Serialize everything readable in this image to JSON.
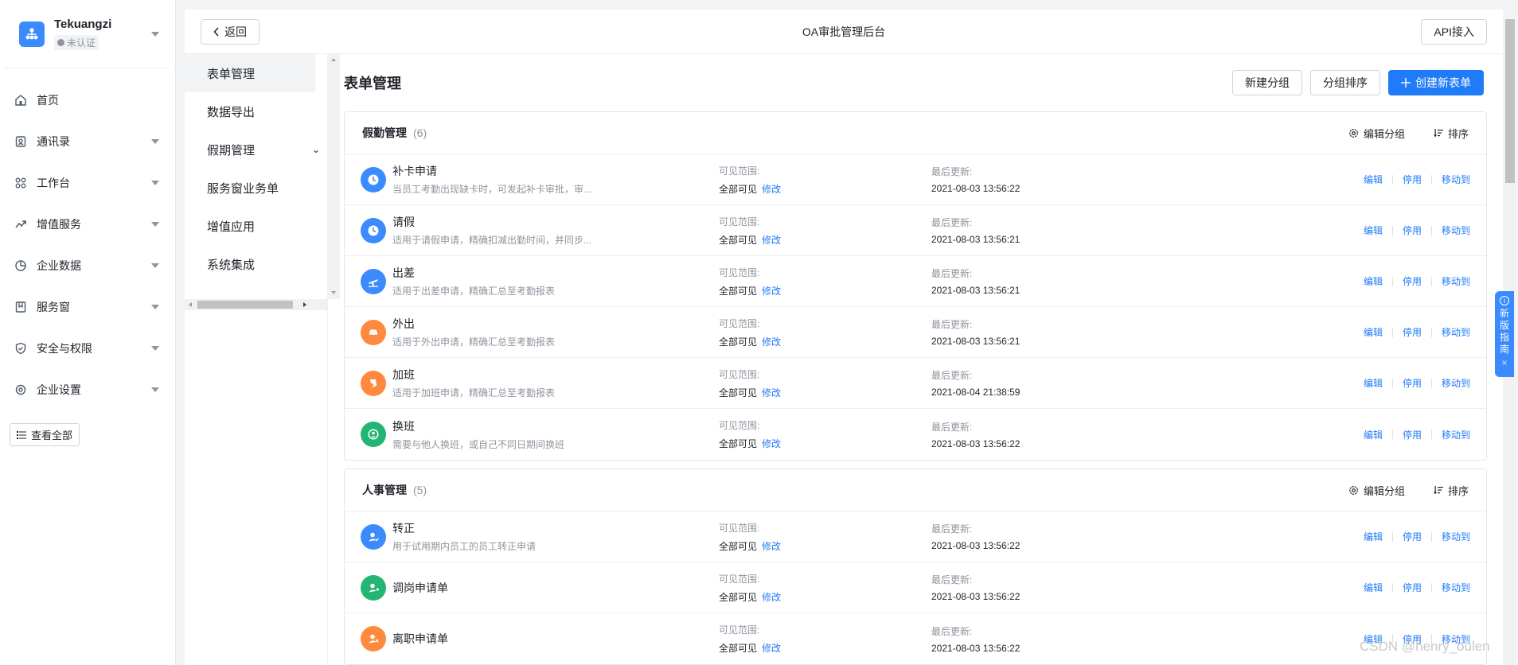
{
  "org": {
    "name": "Tekuangzi",
    "status": "未认证"
  },
  "nav": [
    {
      "label": "首页",
      "icon": "home-icon",
      "caret": false
    },
    {
      "label": "通讯录",
      "icon": "contacts-icon",
      "caret": true
    },
    {
      "label": "工作台",
      "icon": "grid-icon",
      "caret": true
    },
    {
      "label": "增值服务",
      "icon": "trend-icon",
      "caret": true
    },
    {
      "label": "企业数据",
      "icon": "pie-chart-icon",
      "caret": true
    },
    {
      "label": "服务窗",
      "icon": "bookmark-icon",
      "caret": true
    },
    {
      "label": "安全与权限",
      "icon": "shield-icon",
      "caret": true
    },
    {
      "label": "企业设置",
      "icon": "settings-icon",
      "caret": true
    }
  ],
  "view_all": "查看全部",
  "topbar": {
    "back": "返回",
    "title": "OA审批管理后台",
    "api": "API接入"
  },
  "submenu": [
    {
      "label": "表单管理",
      "active": true
    },
    {
      "label": "数据导出"
    },
    {
      "label": "假期管理",
      "expand": "⌄"
    },
    {
      "label": "服务窗业务单"
    },
    {
      "label": "增值应用"
    },
    {
      "label": "系统集成"
    }
  ],
  "main": {
    "title": "表单管理",
    "new_group": "新建分组",
    "sort_groups": "分组排序",
    "create_form": "创建新表单"
  },
  "labels": {
    "scope": "可见范围:",
    "updated": "最后更新:",
    "edit_group": "编辑分组",
    "sort": "排序",
    "modify": "修改",
    "edit": "编辑",
    "disable": "停用",
    "move": "移动到"
  },
  "groups": [
    {
      "name": "假勤管理",
      "count": "(6)",
      "forms": [
        {
          "name": "补卡申请",
          "desc": "当员工考勤出现缺卡时，可发起补卡审批，审...",
          "scope": "全部可见",
          "updated": "2021-08-03 13:56:22",
          "color": "#3b8bff",
          "icon": "clock-icon"
        },
        {
          "name": "请假",
          "desc": "适用于请假申请，精确扣减出勤时间，并同步...",
          "scope": "全部可见",
          "updated": "2021-08-03 13:56:21",
          "color": "#3b8bff",
          "icon": "clock-icon"
        },
        {
          "name": "出差",
          "desc": "适用于出差申请，精确汇总至考勤报表",
          "scope": "全部可见",
          "updated": "2021-08-03 13:56:21",
          "color": "#3b8bff",
          "icon": "plane-icon"
        },
        {
          "name": "外出",
          "desc": "适用于外出申请，精确汇总至考勤报表",
          "scope": "全部可见",
          "updated": "2021-08-03 13:56:21",
          "color": "#ff8a3d",
          "icon": "car-icon"
        },
        {
          "name": "加班",
          "desc": "适用于加班申请，精确汇总至考勤报表",
          "scope": "全部可见",
          "updated": "2021-08-04 21:38:59",
          "color": "#ff8a3d",
          "icon": "overtime-icon"
        },
        {
          "name": "换班",
          "desc": "需要与他人换班，或自己不同日期间换班",
          "scope": "全部可见",
          "updated": "2021-08-03 13:56:22",
          "color": "#22b573",
          "icon": "swap-icon"
        }
      ]
    },
    {
      "name": "人事管理",
      "count": "(5)",
      "forms": [
        {
          "name": "转正",
          "desc": "用于试用期内员工的员工转正申请",
          "scope": "全部可见",
          "updated": "2021-08-03 13:56:22",
          "color": "#3b8bff",
          "icon": "user-check-icon"
        },
        {
          "name": "调岗申请单",
          "desc": "",
          "scope": "全部可见",
          "updated": "2021-08-03 13:56:22",
          "color": "#22b573",
          "icon": "user-transfer-icon"
        },
        {
          "name": "离职申请单",
          "desc": "",
          "scope": "全部可见",
          "updated": "2021-08-03 13:56:22",
          "color": "#ff8a3d",
          "icon": "user-leave-icon"
        }
      ]
    }
  ],
  "guide": {
    "chars": [
      "新",
      "版",
      "指",
      "南"
    ],
    "close": "×"
  },
  "watermark": "CSDN @henry_oulen"
}
